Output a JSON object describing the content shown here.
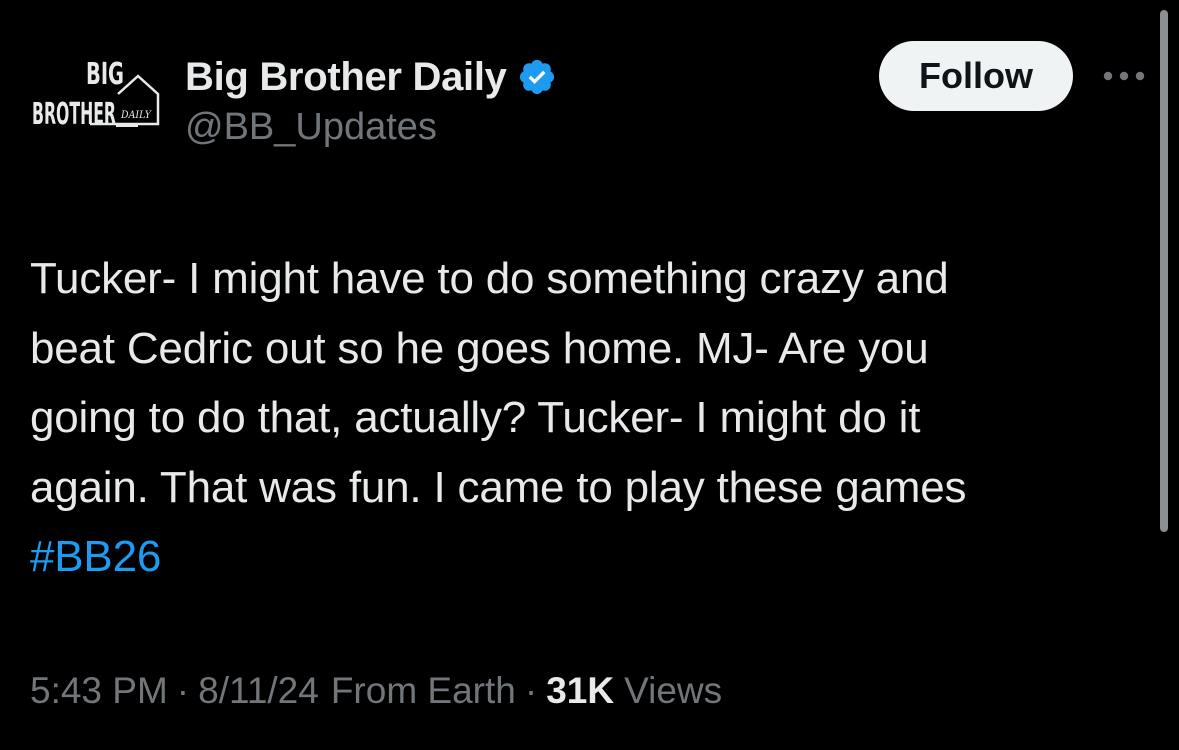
{
  "author": {
    "display_name": "Big Brother Daily",
    "handle": "@BB_Updates",
    "verified": true,
    "avatar_logo": {
      "line1": "BIG",
      "line2": "BROTHER",
      "tag": "DAILY"
    }
  },
  "actions": {
    "follow_label": "Follow",
    "more_icon": "more-horizontal-icon"
  },
  "tweet": {
    "text_lines": [
      "Tucker- I might have to do something crazy and",
      "beat Cedric out so he goes home. MJ- Are you",
      "going to do that, actually? Tucker- I might do it",
      "again. That was fun. I came to play these games"
    ],
    "hashtag": "#BB26"
  },
  "meta": {
    "time": "5:43 PM",
    "separator": "·",
    "date": "8/11/24",
    "source": "From Earth",
    "views_count": "31K",
    "views_label": "Views"
  },
  "colors": {
    "background": "#000000",
    "primary_text": "#e7e9ea",
    "secondary_text": "#71767b",
    "link_blue": "#1d9bf0",
    "verified_blue": "#1d9bf0",
    "follow_bg": "#eff3f4"
  }
}
